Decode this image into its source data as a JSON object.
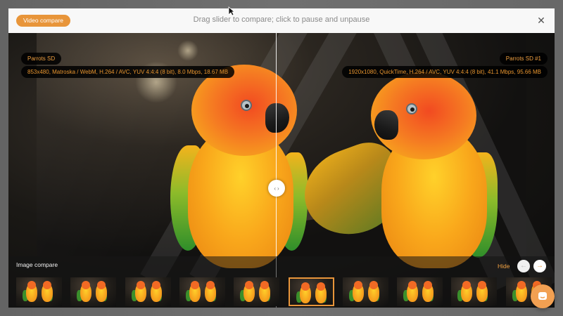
{
  "header": {
    "mode_button": "Video compare",
    "hint": "Drag slider to compare; click to pause and unpause",
    "close_icon": "close-icon"
  },
  "left_video": {
    "name": "Parrots SD",
    "meta": "853x480, Matroska / WebM, H.264 / AVC, YUV 4:4:4 (8 bit), 8.0 Mbps, 18.67 MB"
  },
  "right_video": {
    "name": "Parrots SD #1",
    "meta": "1920x1080, QuickTime, H.264 / AVC, YUV 4:4:4 (8 bit), 41.1 Mbps, 95.66 MB"
  },
  "slider": {
    "left_arrow": "‹",
    "right_arrow": "›"
  },
  "strip": {
    "title": "Image compare",
    "hide": "Hide",
    "prev_icon": "arrow-left-icon",
    "next_icon": "arrow-right-icon",
    "prev_glyph": "←",
    "next_glyph": "→",
    "thumbnail_count": 10,
    "active_index": 5
  },
  "colors": {
    "accent": "#e8953a",
    "label_text": "#f0a040"
  },
  "chat": {
    "icon": "chat-icon"
  }
}
